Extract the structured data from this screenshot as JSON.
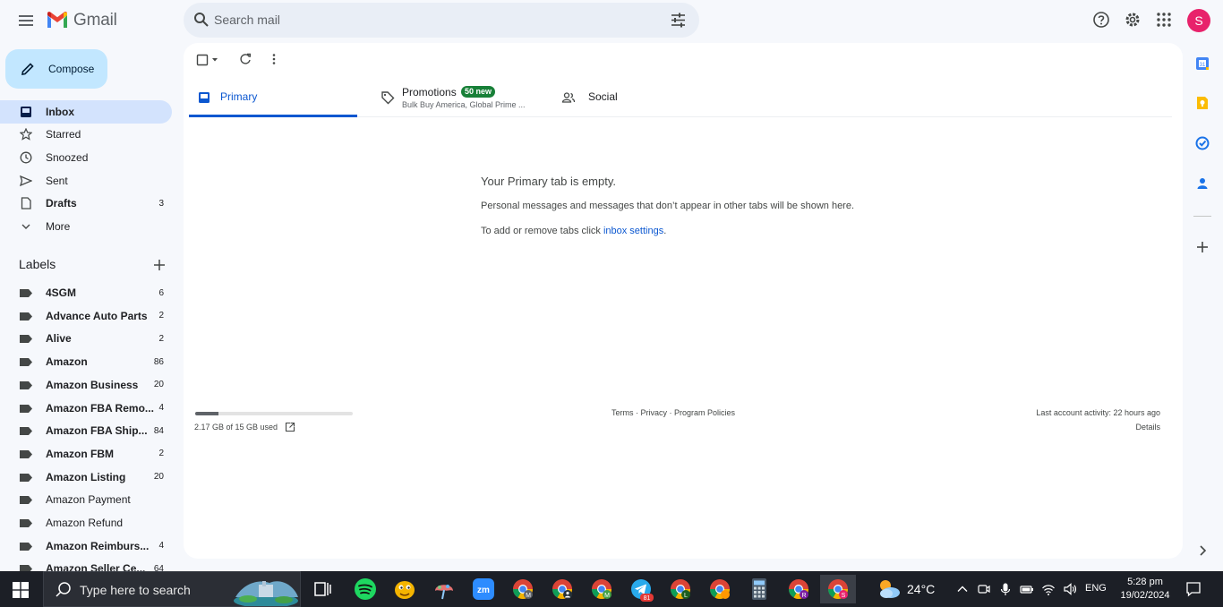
{
  "app": {
    "name": "Gmail",
    "avatar_letter": "S",
    "accent": "#0b57d0",
    "avatar_color": "#e8226b"
  },
  "search": {
    "placeholder": "Search mail"
  },
  "compose": {
    "label": "Compose"
  },
  "nav": [
    {
      "label": "Inbox",
      "count": "",
      "bold": true,
      "active": true,
      "icon": "inbox-icon"
    },
    {
      "label": "Starred",
      "count": "",
      "icon": "star-icon"
    },
    {
      "label": "Snoozed",
      "count": "",
      "icon": "clock-icon"
    },
    {
      "label": "Sent",
      "count": "",
      "icon": "send-icon"
    },
    {
      "label": "Drafts",
      "count": "3",
      "bold": true,
      "icon": "draft-icon"
    },
    {
      "label": "More",
      "count": "",
      "icon": "chevron-down-icon"
    }
  ],
  "labels": {
    "heading": "Labels",
    "items": [
      {
        "label": "4SGM",
        "count": "6",
        "bold": true
      },
      {
        "label": "Advance Auto Parts",
        "count": "2",
        "bold": true
      },
      {
        "label": "Alive",
        "count": "2",
        "bold": true
      },
      {
        "label": "Amazon",
        "count": "86",
        "bold": true
      },
      {
        "label": "Amazon Business",
        "count": "20",
        "bold": true
      },
      {
        "label": "Amazon FBA Remo...",
        "count": "4",
        "bold": true
      },
      {
        "label": "Amazon FBA Ship...",
        "count": "84",
        "bold": true
      },
      {
        "label": "Amazon FBM",
        "count": "2",
        "bold": true
      },
      {
        "label": "Amazon Listing",
        "count": "20",
        "bold": true
      },
      {
        "label": "Amazon Payment",
        "count": "",
        "bold": false
      },
      {
        "label": "Amazon Refund",
        "count": "",
        "bold": false
      },
      {
        "label": "Amazon Reimburs...",
        "count": "4",
        "bold": true
      },
      {
        "label": "Amazon Seller Ce...",
        "count": "64",
        "bold": true
      }
    ]
  },
  "tabs": {
    "primary": "Primary",
    "promotions": "Promotions",
    "promotions_badge": "50 new",
    "promotions_sub": "Bulk Buy America, Global Prime ...",
    "social": "Social"
  },
  "empty": {
    "title": "Your Primary tab is empty.",
    "body": "Personal messages and messages that don’t appear in other tabs will be shown here.",
    "body2_prefix": "To add or remove tabs click ",
    "body2_link": "inbox settings",
    "body2_suffix": "."
  },
  "footer": {
    "storage": "2.17 GB of 15 GB used",
    "storage_fraction": 0.145,
    "terms": "Terms",
    "privacy": "Privacy",
    "policies": "Program Policies",
    "sep": " · ",
    "activity": "Last account activity: 22 hours ago",
    "details": "Details"
  },
  "taskbar": {
    "search_text": "Type here to search",
    "temperature": "24°C",
    "language": "ENG",
    "time": "5:28 pm",
    "date": "19/02/2024",
    "telegram_badge": "81",
    "apps": [
      "task-view-icon",
      "spotify-icon",
      "emoji-app-icon",
      "paint-app-icon",
      "zoom-icon",
      "chrome-m-icon",
      "chrome-a-icon",
      "chrome-m2-icon",
      "telegram-icon",
      "chrome-l-icon",
      "chrome-icon",
      "calculator-icon",
      "chrome-r-icon",
      "chrome-s-icon"
    ]
  }
}
